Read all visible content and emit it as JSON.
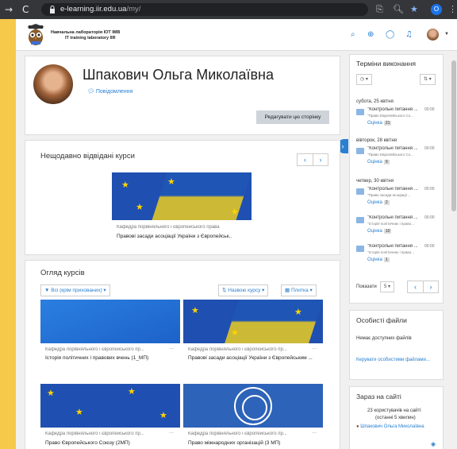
{
  "browser": {
    "url_host": "e-learning.iir.edu.ua",
    "url_path": "/my/",
    "profile_initial": "O"
  },
  "header": {
    "brand_line1": "Навчальна лабораторія IOT IMB",
    "brand_line2": "IT training laboratory IIR"
  },
  "profile": {
    "name": "Шпакович Ольга Миколаївна",
    "message_link": "Повідомлення",
    "edit_button": "Редагувати цю сторінку"
  },
  "recent": {
    "title": "Нещодавно відвідані курси",
    "course": {
      "category": "Кафедра порівняльного і європейського права",
      "name": "Правові засади асоціації України з Європейськ.."
    }
  },
  "overview": {
    "title": "Огляд курсів",
    "filter_label": "Всі (крім прихованих)",
    "sort_label": "Назвою курсу",
    "view_label": "Плитка",
    "courses": [
      {
        "category": "Кафедра порівняльного і європейського пр...",
        "name": "Історія політичних і правових вчень (1_МП)"
      },
      {
        "category": "Кафедра порівняльного і європейського пр...",
        "name": "Правові засади асоціації України з Європейським ..."
      },
      {
        "category": "Кафедра порівняльного і європейського пр...",
        "name": "Право Європейського Союзу (2МП)"
      },
      {
        "category": "Кафедра порівняльного і європейського пр...",
        "name": "Право міжнародних організацій (3 МП)"
      }
    ]
  },
  "timeline": {
    "title": "Терміни виконання",
    "groups": [
      {
        "date": "субота, 25 квітня",
        "events": [
          {
            "title": "\"Контрольні питання ...",
            "time": "00:00",
            "course": "\"Право Європейського Со...",
            "grade_label": "Оцінка",
            "grade": "21"
          }
        ]
      },
      {
        "date": "вівторок, 28 квітня",
        "events": [
          {
            "title": "\"Контрольні питання ...",
            "time": "00:00",
            "course": "\"Право Європейського Со...",
            "grade_label": "Оцінка",
            "grade": "9"
          }
        ]
      },
      {
        "date": "четвер, 30 квітня",
        "events": [
          {
            "title": "\"Контрольні питання ...",
            "time": "00:00",
            "course": "\"Право засади асоціації ...",
            "grade_label": "Оцінка",
            "grade": "2"
          },
          {
            "title": "\"Контрольні питання ...",
            "time": "00:00",
            "course": "\"Історія політичних і право...",
            "grade_label": "Оцінка",
            "grade": "10"
          },
          {
            "title": "\"Контрольні питання ...",
            "time": "00:00",
            "course": "\"Історія політичних і право...",
            "grade_label": "Оцінка",
            "grade": "1"
          }
        ]
      }
    ],
    "show_label": "Показати",
    "show_value": "5"
  },
  "private_files": {
    "title": "Особисті файли",
    "empty_text": "Немає доступних файлів",
    "manage_link": "Керувати особистими файлами..."
  },
  "online": {
    "title": "Зараз на сайті",
    "summary": "23 користувачів на сайті",
    "summary2": "(останні 5 хвилин)",
    "user": "Шпакович Ольга Миколаївна"
  },
  "colors": {
    "accent": "#2a80d1",
    "frame": "#f6c94a"
  }
}
